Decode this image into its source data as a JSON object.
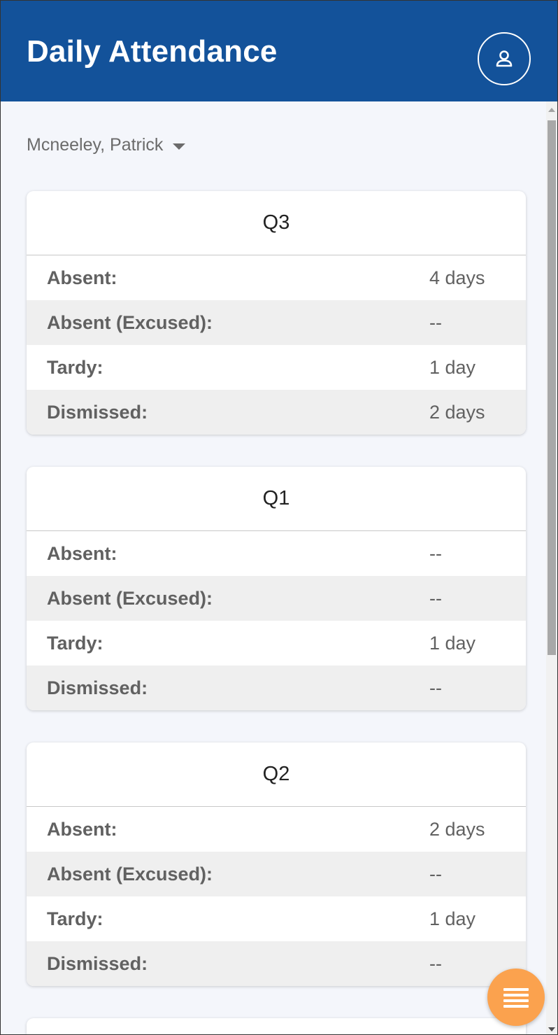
{
  "header": {
    "title": "Daily Attendance",
    "profile_icon": "user-icon",
    "background_color": "#13529a"
  },
  "student_selector": {
    "selected": "Mcneeley, Patrick",
    "icon": "caret-down-icon"
  },
  "cards": [
    {
      "title": "Q3",
      "rows": [
        {
          "label": "Absent:",
          "value": "4 days"
        },
        {
          "label": "Absent (Excused):",
          "value": "--"
        },
        {
          "label": "Tardy:",
          "value": "1 day"
        },
        {
          "label": "Dismissed:",
          "value": "2 days"
        }
      ]
    },
    {
      "title": "Q1",
      "rows": [
        {
          "label": "Absent:",
          "value": "--"
        },
        {
          "label": "Absent (Excused):",
          "value": "--"
        },
        {
          "label": "Tardy:",
          "value": "1 day"
        },
        {
          "label": "Dismissed:",
          "value": "--"
        }
      ]
    },
    {
      "title": "Q2",
      "rows": [
        {
          "label": "Absent:",
          "value": "2 days"
        },
        {
          "label": "Absent (Excused):",
          "value": "--"
        },
        {
          "label": "Tardy:",
          "value": "1 day"
        },
        {
          "label": "Dismissed:",
          "value": "--"
        }
      ]
    }
  ],
  "fab": {
    "icon": "menu-icon",
    "color": "#fba24e"
  }
}
